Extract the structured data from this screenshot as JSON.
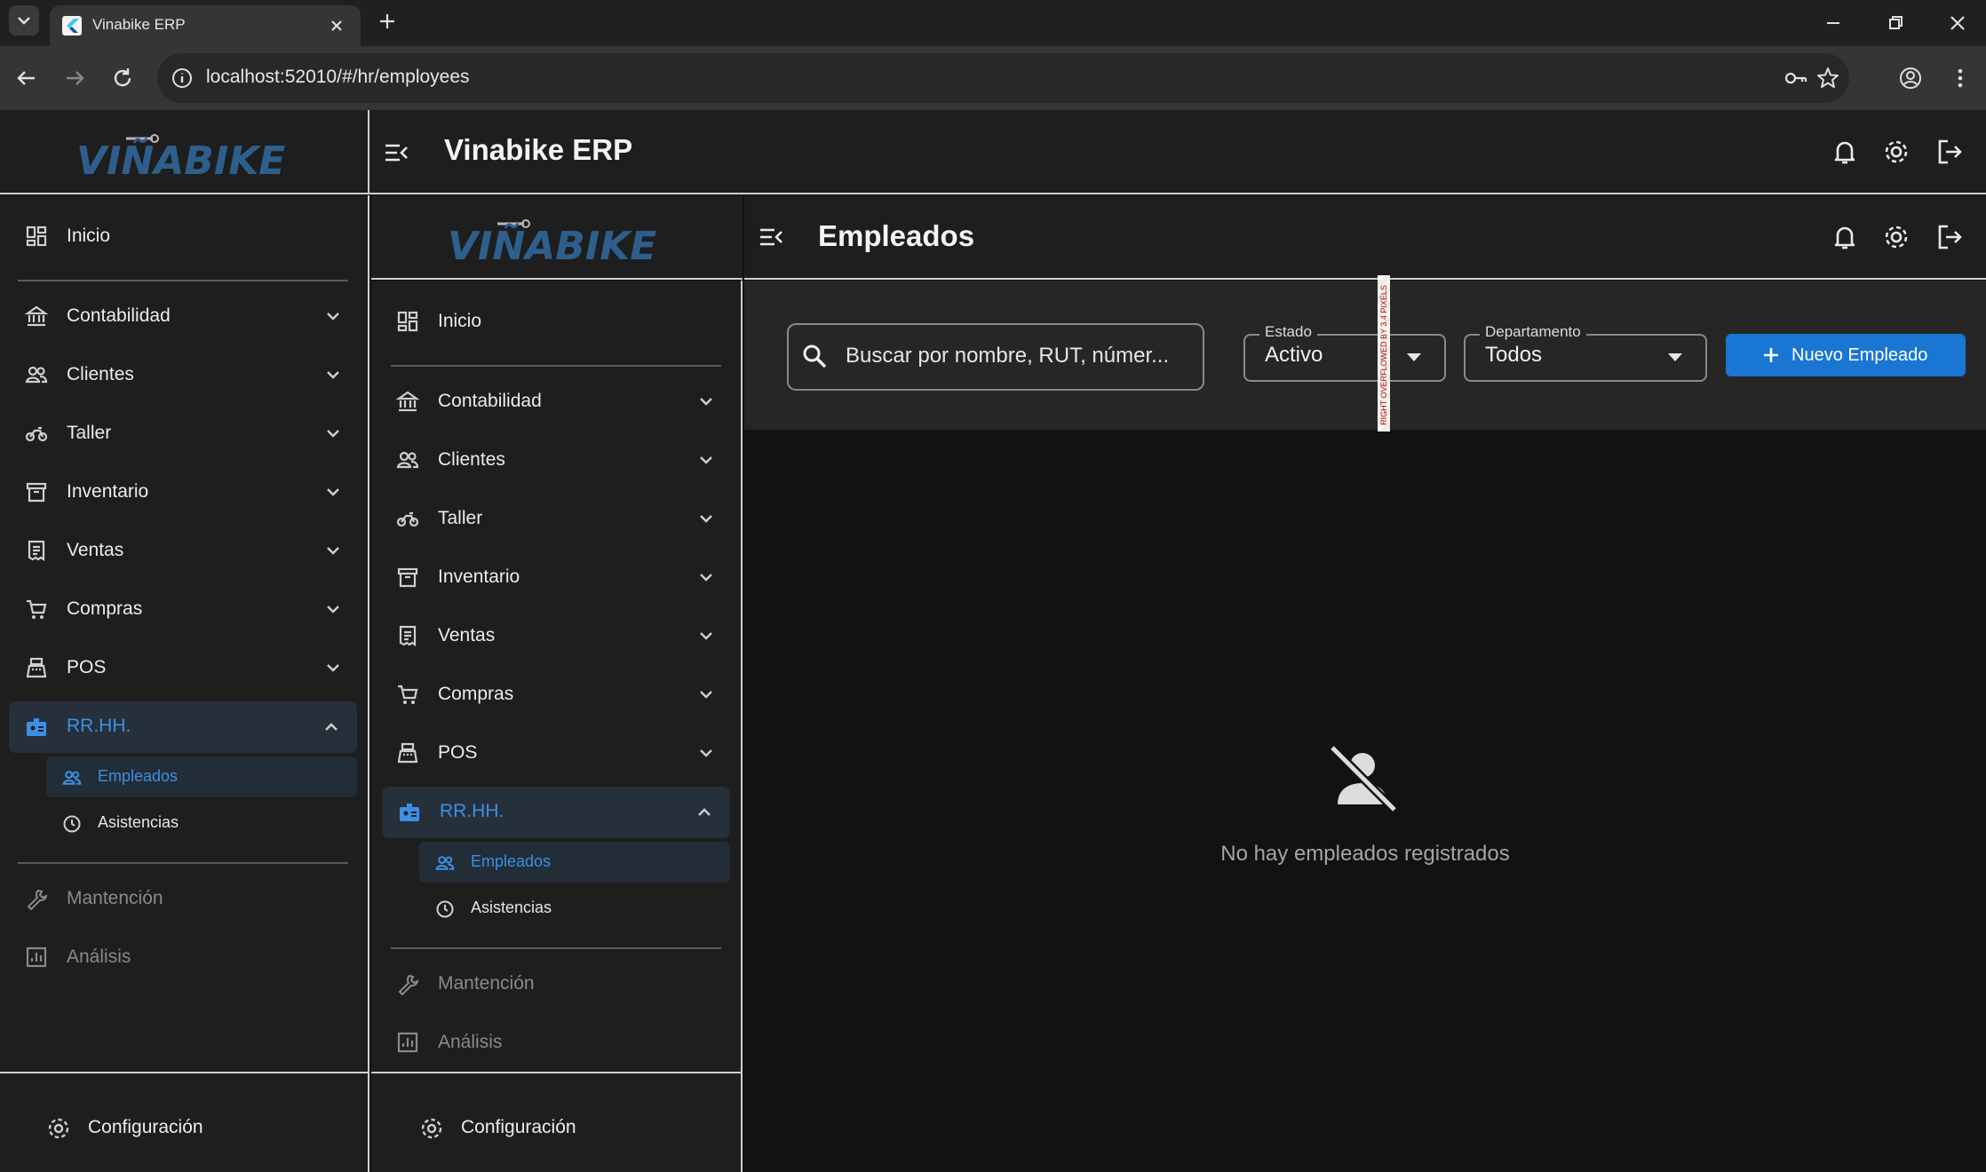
{
  "browser": {
    "tab_title": "Vinabike ERP",
    "url": "localhost:52010/#/hr/employees"
  },
  "app": {
    "logo_text": "VIÑABIKE",
    "title": "Vinabike ERP"
  },
  "sidebar": {
    "items": [
      {
        "label": "Inicio",
        "icon": "dashboard-icon"
      },
      {
        "label": "Contabilidad",
        "icon": "bank-icon"
      },
      {
        "label": "Clientes",
        "icon": "people-icon"
      },
      {
        "label": "Taller",
        "icon": "motorbike-icon"
      },
      {
        "label": "Inventario",
        "icon": "archive-icon"
      },
      {
        "label": "Ventas",
        "icon": "receipt-icon"
      },
      {
        "label": "Compras",
        "icon": "cart-icon"
      },
      {
        "label": "POS",
        "icon": "register-icon"
      },
      {
        "label": "RR.HH.",
        "icon": "badge-icon"
      }
    ],
    "sub_items": [
      {
        "label": "Empleados",
        "icon": "people-icon"
      },
      {
        "label": "Asistencias",
        "icon": "clock-icon"
      }
    ],
    "disabled_items": [
      {
        "label": "Mantención",
        "icon": "wrench-icon"
      },
      {
        "label": "Análisis",
        "icon": "analytics-icon"
      }
    ],
    "footer": {
      "label": "Configuración",
      "icon": "gear-icon"
    }
  },
  "page": {
    "title": "Empleados",
    "search_placeholder": "Buscar por nombre, RUT, númer...",
    "estado_label": "Estado",
    "estado_value": "Activo",
    "departamento_label": "Departamento",
    "departamento_value": "Todos",
    "new_button": "Nuevo Empleado",
    "overflow_warning": "RIGHT OVERFLOWED BY 3.4 PIXELS",
    "empty_message": "No hay empleados registrados"
  },
  "colors": {
    "accent": "#1976d2",
    "accent_text": "#3d8fe6",
    "background": "#121212",
    "surface": "#1e1e1e"
  }
}
